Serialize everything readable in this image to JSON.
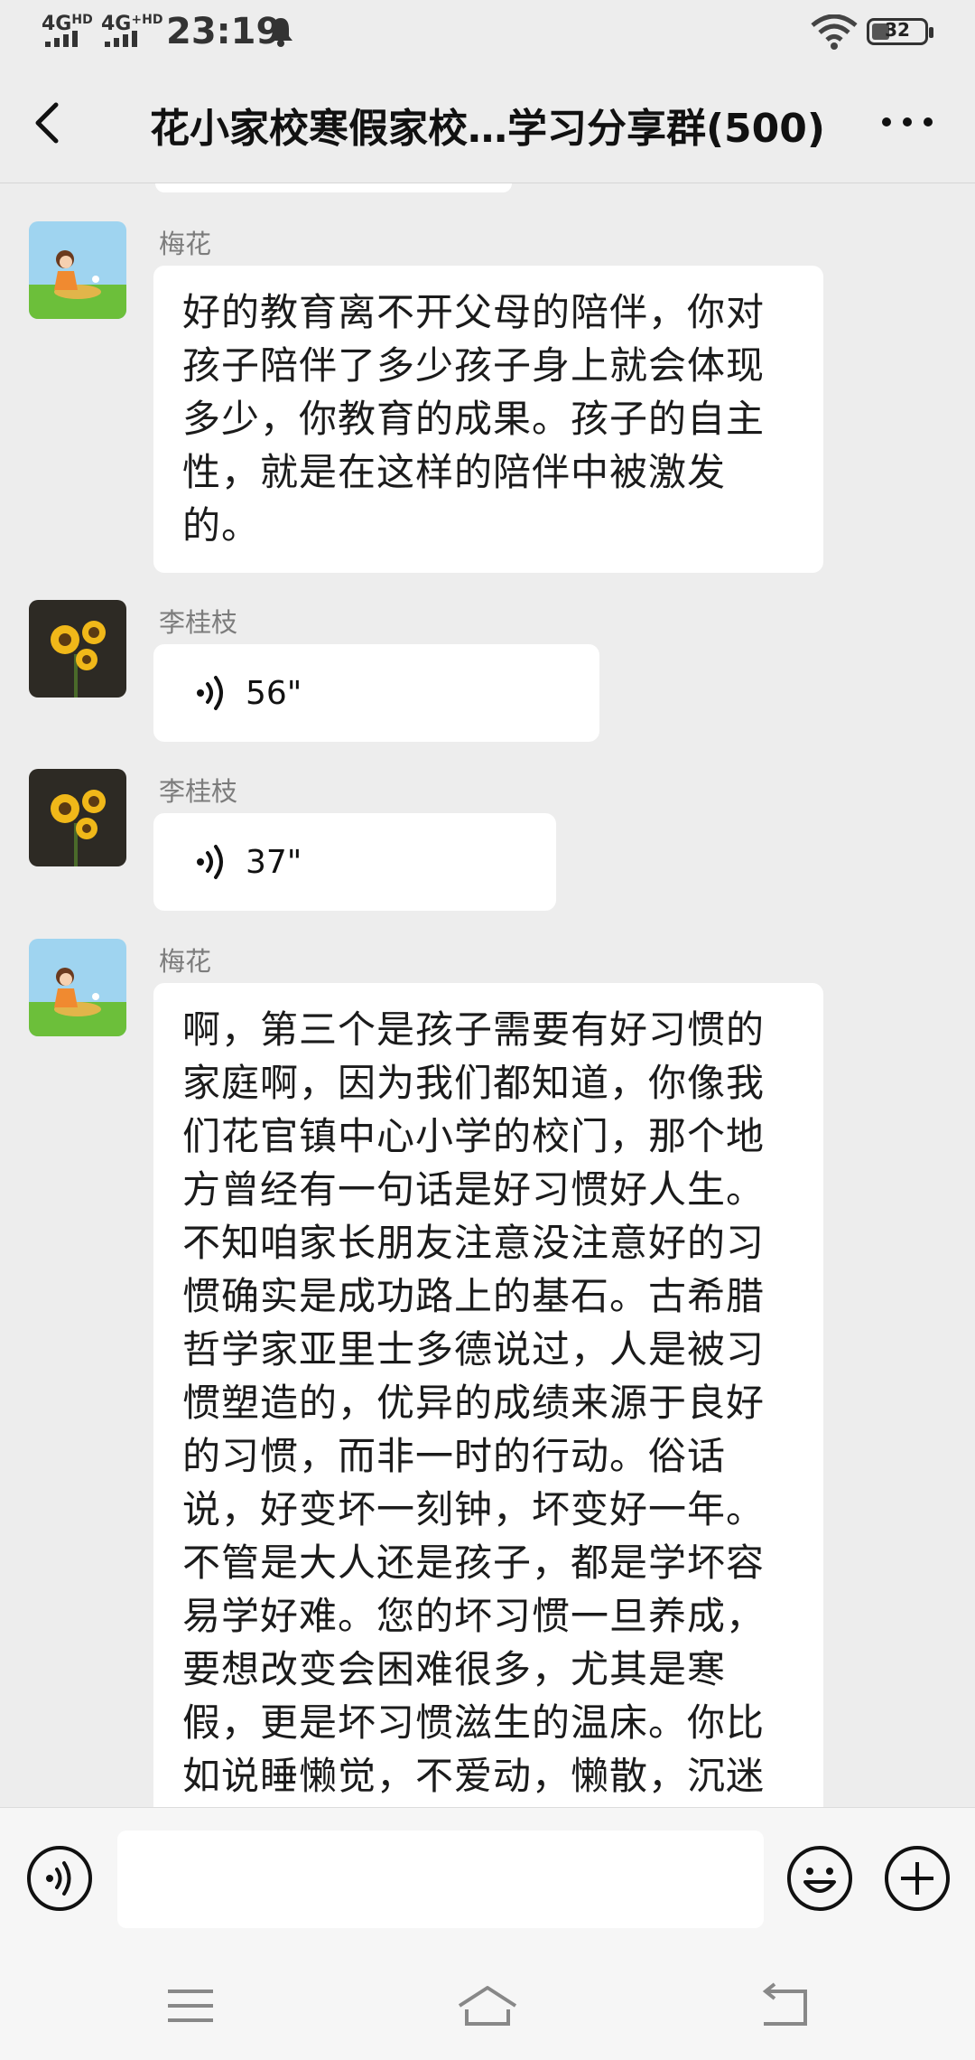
{
  "status_bar": {
    "network_1": "4G",
    "network_1_sup": "HD",
    "network_2": "4G",
    "network_2_sup": "+HD",
    "time": "23:19",
    "battery": "32",
    "icons": [
      "signal-icon",
      "bell-icon",
      "wifi-icon",
      "battery-icon"
    ]
  },
  "header": {
    "title": "花小家校寒假家校…学习分享群(500)",
    "back_icon": "chevron-left-icon",
    "more_icon": "more-dots-icon"
  },
  "messages": [
    {
      "sender": "梅花",
      "type": "text",
      "text": "好的教育离不开父母的陪伴，你对\n孩子陪伴了多少孩子身上就会体现\n多少，你教育的成果。孩子的自主\n性，就是在这样的陪伴中被激发\n的。"
    },
    {
      "sender": "李桂枝",
      "type": "voice",
      "duration": "56\""
    },
    {
      "sender": "李桂枝",
      "type": "voice",
      "duration": "37\""
    },
    {
      "sender": "梅花",
      "type": "text",
      "text": "啊，第三个是孩子需要有好习惯的\n家庭啊，因为我们都知道，你像我\n们花官镇中心小学的校门，那个地\n方曾经有一句话是好习惯好人生。\n不知咱家长朋友注意没注意好的习\n惯确实是成功路上的基石。古希腊\n哲学家亚里士多德说过，人是被习\n惯塑造的，优异的成绩来源于良好\n的习惯，而非一时的行动。俗话\n说，好变坏一刻钟，坏变好一年。\n不管是大人还是孩子，都是学坏容\n易学好难。您的坏习惯一旦养成，\n要想改变会困难很多，尤其是寒\n假，更是坏习惯滋生的温床。你比\n如说睡懒觉，不爱动，懒散，沉迷"
    }
  ],
  "input_bar": {
    "voice_icon": "voice-toggle-icon",
    "emoji_icon": "emoji-icon",
    "add_icon": "add-icon",
    "placeholder": ""
  },
  "nav_bar": {
    "icons": [
      "menu-icon",
      "home-icon",
      "back-icon"
    ]
  },
  "colors": {
    "background": "#ededed",
    "bubble": "#ffffff",
    "sender_name": "#7c7c7c"
  }
}
